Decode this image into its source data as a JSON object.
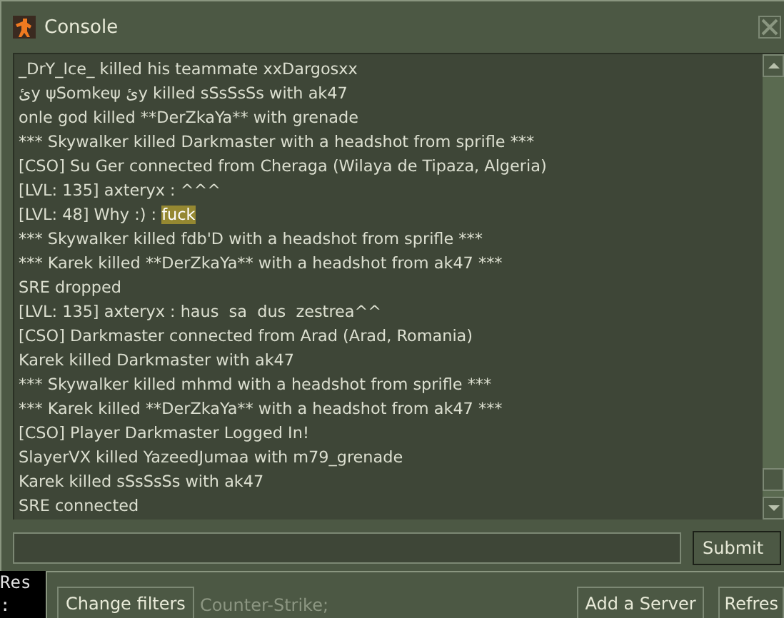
{
  "window": {
    "title": "Console"
  },
  "log": [
    {
      "text": "_DrY_Ice_ killed his teammate xxDargosxx"
    },
    {
      "text": "ئy ψSomkeψ ئy killed sSsSsSs with ak47"
    },
    {
      "text": "onle god killed **DerZkaYa** with grenade"
    },
    {
      "text": "*** Skywalker killed Darkmaster with a headshot from sprifle ***"
    },
    {
      "text": "[CSO] Su Ger connected from Cheraga (Wilaya de Tipaza, Algeria)"
    },
    {
      "text": "[LVL: 135] axteryx : ^^^"
    },
    {
      "text": "[LVL: 48] Why :) : ",
      "selection": "fuck"
    },
    {
      "text": "*** Skywalker killed fdb'D with a headshot from sprifle ***"
    },
    {
      "text": "*** Karek killed **DerZkaYa** with a headshot from ak47 ***"
    },
    {
      "text": "SRE dropped"
    },
    {
      "text": "[LVL: 135] axteryx : haus  sa  dus  zestrea^^"
    },
    {
      "text": "[CSO] Darkmaster connected from Arad (Arad, Romania)"
    },
    {
      "text": "Karek killed Darkmaster with ak47"
    },
    {
      "text": "*** Skywalker killed mhmd with a headshot from sprifle ***"
    },
    {
      "text": "*** Karek killed **DerZkaYa** with a headshot from ak47 ***"
    },
    {
      "text": "[CSO] Player Darkmaster Logged In!"
    },
    {
      "text": "SlayerVX killed YazeedJumaa with m79_grenade"
    },
    {
      "text": "Karek killed sSsSsSs with ak47"
    },
    {
      "text": "SRE connected"
    }
  ],
  "submit_button": "Submit",
  "background_window": {
    "side_text": [
      "Res",
      ":"
    ],
    "filter_button": "Change filters",
    "filter_summary": "Counter-Strike;",
    "add_server_button": "Add a Server",
    "refresh_button": "Refres"
  }
}
